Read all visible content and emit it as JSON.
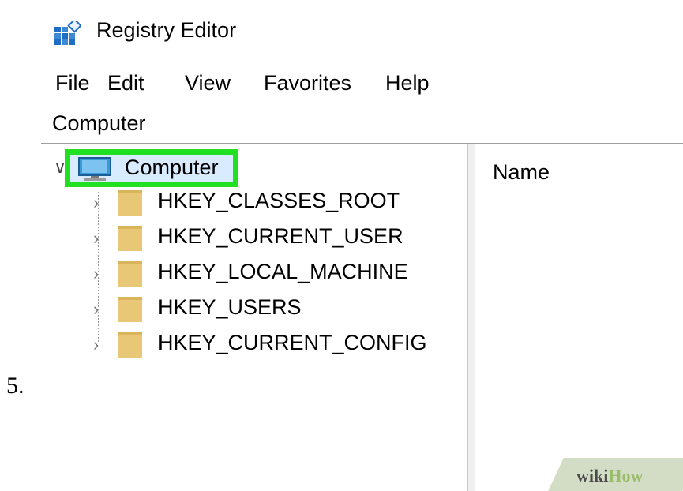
{
  "step": {
    "number": "5."
  },
  "window": {
    "title": "Registry Editor",
    "app_icon": "registry-editor-icon"
  },
  "menu": {
    "items": [
      {
        "label": "File"
      },
      {
        "label": "Edit"
      },
      {
        "label": "View"
      },
      {
        "label": "Favorites"
      },
      {
        "label": "Help"
      }
    ]
  },
  "address": {
    "path": "Computer"
  },
  "tree": {
    "root": {
      "label": "Computer",
      "icon": "computer-icon",
      "expanded": true,
      "selected": true
    },
    "items": [
      {
        "label": "HKEY_CLASSES_ROOT",
        "icon": "folder-icon"
      },
      {
        "label": "HKEY_CURRENT_USER",
        "icon": "folder-icon"
      },
      {
        "label": "HKEY_LOCAL_MACHINE",
        "icon": "folder-icon"
      },
      {
        "label": "HKEY_USERS",
        "icon": "folder-icon"
      },
      {
        "label": "HKEY_CURRENT_CONFIG",
        "icon": "folder-icon"
      }
    ]
  },
  "values": {
    "column_header": "Name"
  },
  "watermark": {
    "part1": "wiki",
    "part2": "How"
  },
  "colors": {
    "highlight": "#21e021",
    "folder": "#e8c877",
    "selection": "#d9ecff"
  }
}
